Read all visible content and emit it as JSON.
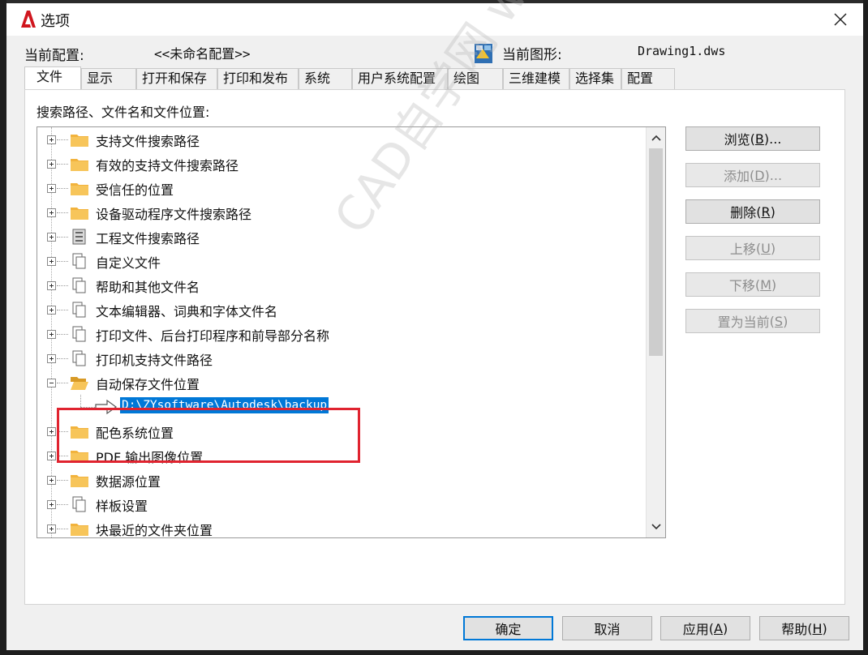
{
  "window": {
    "title": "选项"
  },
  "header": {
    "profile_label": "当前配置:",
    "profile_value": "<<未命名配置>>",
    "drawing_label": "当前图形:",
    "drawing_value": "Drawing1.dws"
  },
  "tabs": [
    {
      "label": "文件",
      "active": true
    },
    {
      "label": "显示"
    },
    {
      "label": "打开和保存"
    },
    {
      "label": "打印和发布"
    },
    {
      "label": "系统"
    },
    {
      "label": "用户系统配置"
    },
    {
      "label": "绘图"
    },
    {
      "label": "三维建模"
    },
    {
      "label": "选择集"
    },
    {
      "label": "配置"
    }
  ],
  "panel": {
    "heading": "搜索路径、文件名和文件位置:"
  },
  "tree": {
    "items": [
      {
        "label": "支持文件搜索路径",
        "icon": "folder-icon"
      },
      {
        "label": "有效的支持文件搜索路径",
        "icon": "folder-icon"
      },
      {
        "label": "受信任的位置",
        "icon": "folder-icon"
      },
      {
        "label": "设备驱动程序文件搜索路径",
        "icon": "folder-icon"
      },
      {
        "label": "工程文件搜索路径",
        "icon": "cabinet-icon"
      },
      {
        "label": "自定义文件",
        "icon": "files-icon"
      },
      {
        "label": "帮助和其他文件名",
        "icon": "files-icon"
      },
      {
        "label": "文本编辑器、词典和字体文件名",
        "icon": "files-icon"
      },
      {
        "label": "打印文件、后台打印程序和前导部分名称",
        "icon": "files-icon"
      },
      {
        "label": "打印机支持文件路径",
        "icon": "files-icon"
      },
      {
        "label": "自动保存文件位置",
        "icon": "open-folder-icon",
        "expanded": true
      },
      {
        "label": "配色系统位置",
        "icon": "folder-icon"
      },
      {
        "label": "PDF 输出图像位置",
        "icon": "folder-icon"
      },
      {
        "label": "数据源位置",
        "icon": "folder-icon"
      },
      {
        "label": "样板设置",
        "icon": "files-icon"
      },
      {
        "label": "块最近的文件夹位置",
        "icon": "folder-icon"
      }
    ],
    "autosave_path": "D:\\ZYsoftware\\Autodesk\\backup"
  },
  "side_buttons": {
    "browse": {
      "label": "浏览",
      "key": "B",
      "suffix": "..."
    },
    "add": {
      "label": "添加",
      "key": "D",
      "suffix": "..."
    },
    "remove": {
      "label": "删除",
      "key": "R",
      "suffix": ""
    },
    "move_up": {
      "label": "上移",
      "key": "U",
      "suffix": ""
    },
    "move_down": {
      "label": "下移",
      "key": "M",
      "suffix": ""
    },
    "set_current": {
      "label": "置为当前",
      "key": "S",
      "suffix": ""
    }
  },
  "watermark": "CAD自学网 www.cadzxw.com",
  "footer": {
    "ok": "确定",
    "cancel": "取消",
    "apply": {
      "label": "应用",
      "key": "A"
    },
    "help": {
      "label": "帮助",
      "key": "H"
    }
  },
  "colors": {
    "selection": "#0078d7",
    "highlight_border": "#e0232f",
    "folder": "#f2b33d"
  }
}
